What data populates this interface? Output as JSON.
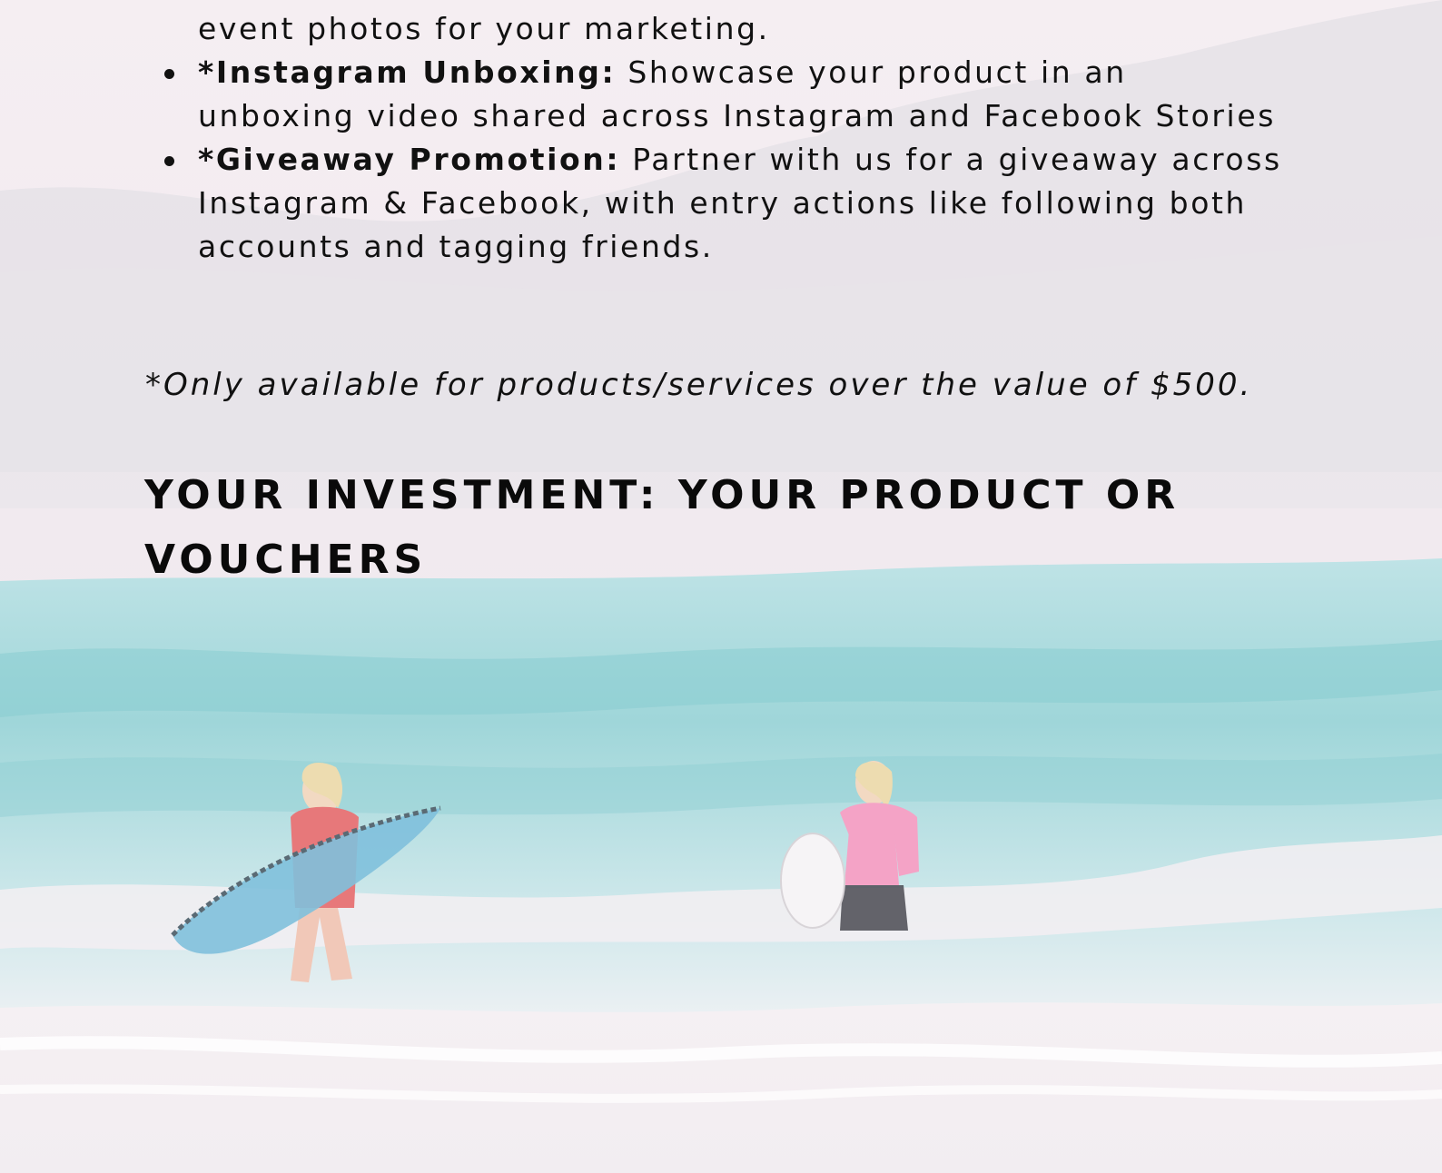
{
  "list_fragment": "event photos for your marketing.",
  "list_items": [
    {
      "title": "*Instagram Unboxing:",
      "text": " Showcase your product in an unboxing video shared across Instagram and Facebook Stories"
    },
    {
      "title": "*Giveaway Promotion:",
      "text": " Partner with us for a giveaway across Instagram & Facebook, with entry actions like following both accounts and tagging friends."
    }
  ],
  "footnote": "*Only available for products/services over the value of $500.",
  "heading": "YOUR INVESTMENT: YOUR PRODUCT OR VOUCHERS",
  "colors": {
    "text": "#111111",
    "sky_tint": "#f4ecf0",
    "sea": "#9ed6d8",
    "foam": "#f7f0f3",
    "rashguard_pink": "#f4a3c6",
    "rashguard_red": "#e7787a",
    "surfboard_blue": "#7fc0db"
  },
  "image": {
    "description_icon": "beach-surfers-photo"
  }
}
